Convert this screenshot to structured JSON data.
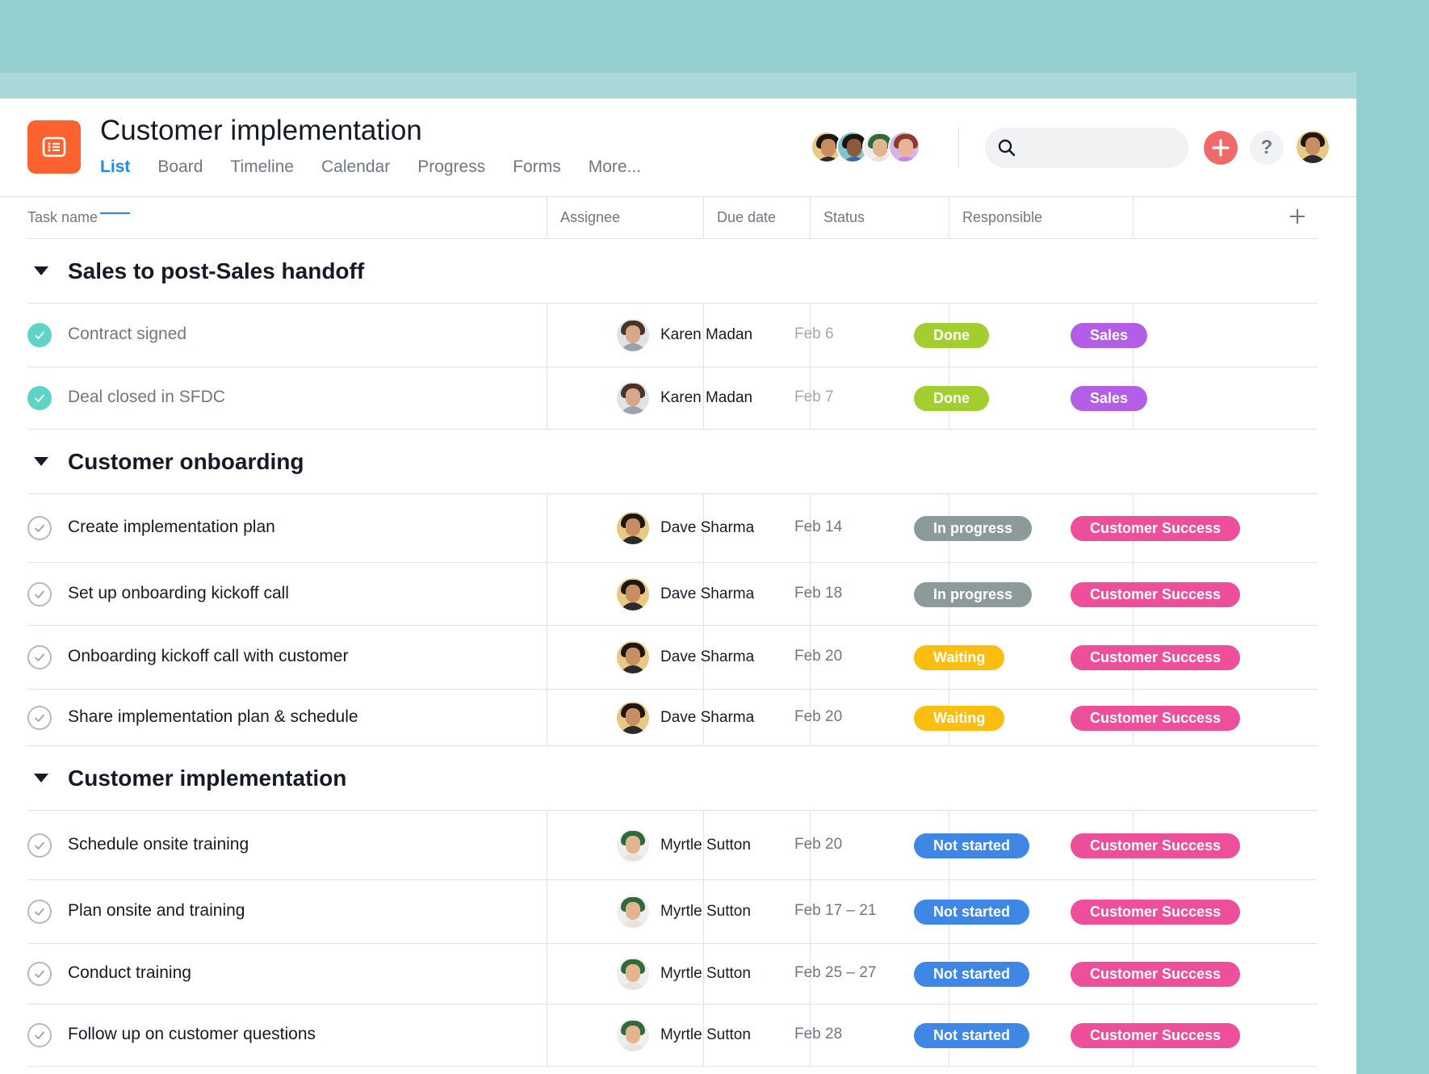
{
  "header": {
    "project_title": "Customer implementation",
    "tabs": [
      "List",
      "Board",
      "Timeline",
      "Calendar",
      "Progress",
      "Forms",
      "More..."
    ],
    "active_tab": "List",
    "search": {
      "value": "",
      "placeholder": ""
    },
    "help_label": "?"
  },
  "columns": [
    "Task name",
    "Assignee",
    "Due date",
    "Status",
    "Responsible"
  ],
  "people": {
    "karen": {
      "name": "Karen Madan",
      "skin": "#d7a78a",
      "hair": "#4a3326",
      "shirt": "#9aa3ad",
      "bg": "#dfe3e7"
    },
    "dave": {
      "name": "Dave Sharma",
      "skin": "#c98d62",
      "hair": "#1e1613",
      "shirt": "#2b2b2b",
      "bg": "#e7c985"
    },
    "myrtle": {
      "name": "Myrtle Sutton",
      "skin": "#e3b58f",
      "hair": "#2e6a3c",
      "shirt": "#e9e3dc",
      "bg": "#eeeeee"
    },
    "member4": {
      "skin": "#e7b49a",
      "hair": "#8a3b2c",
      "shirt": "#c38cd9",
      "bg": "#d6b6e8"
    },
    "member2": {
      "skin": "#8a5a3c",
      "hair": "#1b1410",
      "shirt": "#3a6aa0",
      "bg": "#7fc6c9"
    }
  },
  "colors": {
    "Done": "#a2cf2f",
    "In progress": "#8d9a9a",
    "Waiting": "#fbbd0f",
    "Not started": "#3f87e5",
    "Sales": "#b25ee6",
    "Customer Success": "#ee4f9a"
  },
  "sections": [
    {
      "title": "Sales to post-Sales handoff",
      "tasks": [
        {
          "name": "Contract signed",
          "assignee": "Karen Madan",
          "due": "Feb 6",
          "status": "Done",
          "responsible": "Sales",
          "done": true
        },
        {
          "name": "Deal closed in SFDC",
          "assignee": "Karen Madan",
          "due": "Feb 7",
          "status": "Done",
          "responsible": "Sales",
          "done": true
        }
      ]
    },
    {
      "title": "Customer onboarding",
      "tasks": [
        {
          "name": "Create implementation plan",
          "assignee": "Dave Sharma",
          "due": "Feb 14",
          "status": "In progress",
          "responsible": "Customer Success",
          "done": false
        },
        {
          "name": "Set up onboarding kickoff call",
          "assignee": "Dave Sharma",
          "due": "Feb 18",
          "status": "In progress",
          "responsible": "Customer Success",
          "done": false
        },
        {
          "name": "Onboarding kickoff call with customer",
          "assignee": "Dave Sharma",
          "due": "Feb 20",
          "status": "Waiting",
          "responsible": "Customer Success",
          "done": false
        },
        {
          "name": "Share implementation plan & schedule",
          "assignee": "Dave Sharma",
          "due": "Feb 20",
          "status": "Waiting",
          "responsible": "Customer Success",
          "done": false
        }
      ]
    },
    {
      "title": "Customer implementation",
      "tasks": [
        {
          "name": "Schedule onsite training",
          "assignee": "Myrtle Sutton",
          "due": "Feb 20",
          "status": "Not started",
          "responsible": "Customer Success",
          "done": false
        },
        {
          "name": "Plan onsite and training",
          "assignee": "Myrtle Sutton",
          "due": "Feb 17 – 21",
          "status": "Not started",
          "responsible": "Customer Success",
          "done": false
        },
        {
          "name": "Conduct training",
          "assignee": "Myrtle Sutton",
          "due": "Feb 25 – 27",
          "status": "Not started",
          "responsible": "Customer Success",
          "done": false
        },
        {
          "name": "Follow up on customer questions",
          "assignee": "Myrtle Sutton",
          "due": "Feb 28",
          "status": "Not started",
          "responsible": "Customer Success",
          "done": false
        }
      ]
    }
  ]
}
